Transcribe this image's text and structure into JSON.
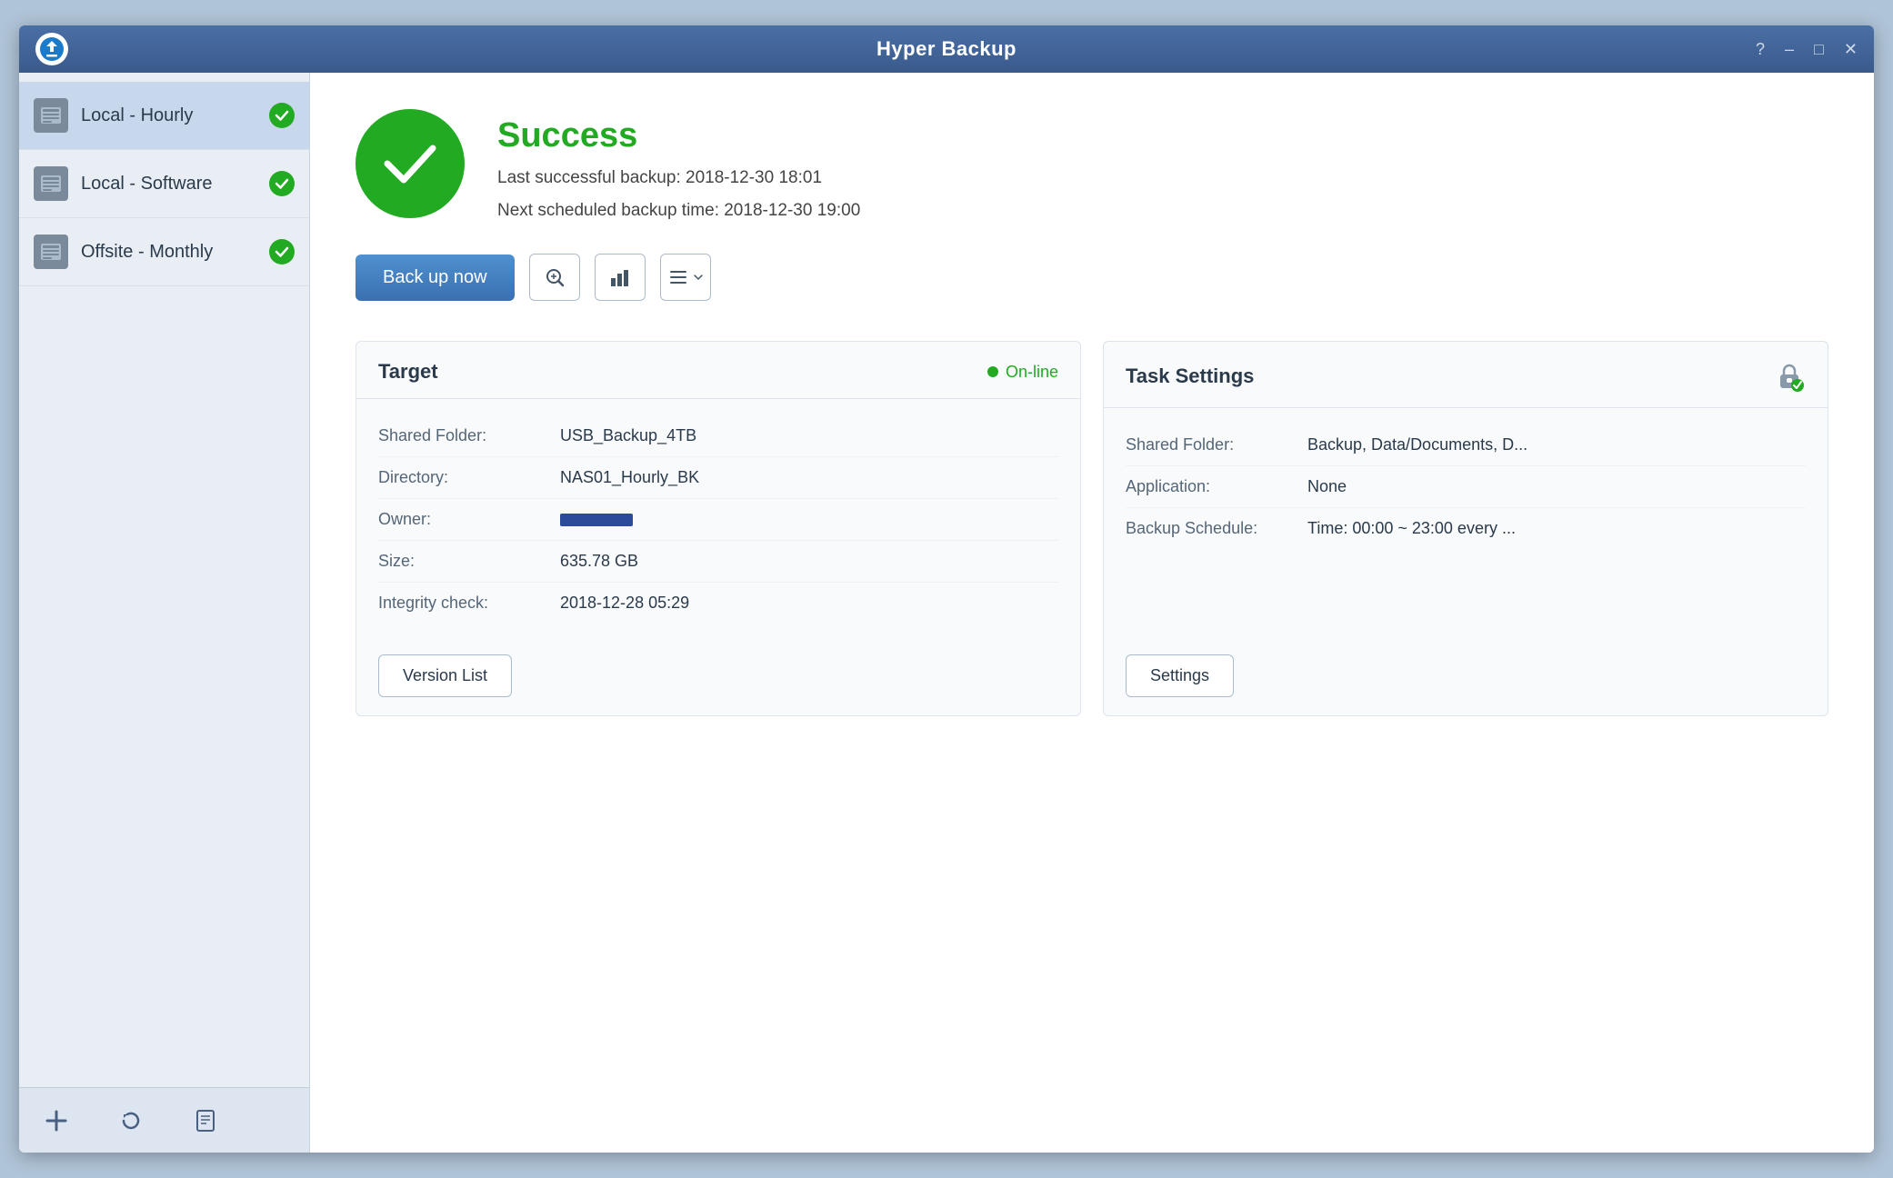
{
  "app": {
    "title": "Hyper Backup"
  },
  "titlebar": {
    "help_label": "?",
    "minimize_label": "–",
    "maximize_label": "□",
    "close_label": "✕"
  },
  "sidebar": {
    "items": [
      {
        "id": "local-hourly",
        "label": "Local - Hourly",
        "status": "success",
        "active": true
      },
      {
        "id": "local-software",
        "label": "Local - Software",
        "status": "success",
        "active": false
      },
      {
        "id": "offsite-monthly",
        "label": "Offsite - Monthly",
        "status": "success",
        "active": false
      }
    ],
    "footer_buttons": [
      {
        "id": "add",
        "icon": "+"
      },
      {
        "id": "restore",
        "icon": "↺"
      },
      {
        "id": "log",
        "icon": "📄"
      }
    ]
  },
  "main": {
    "status": {
      "title": "Success",
      "last_backup": "Last successful backup: 2018-12-30 18:01",
      "next_backup": "Next scheduled backup time: 2018-12-30 19:00"
    },
    "actions": {
      "back_up_now": "Back up now",
      "search_tooltip": "Browse backup versions",
      "chart_tooltip": "Backup statistics",
      "menu_tooltip": "More options"
    },
    "target_panel": {
      "title": "Target",
      "online_status": "On-line",
      "fields": [
        {
          "label": "Shared Folder:",
          "value": "USB_Backup_4TB"
        },
        {
          "label": "Directory:",
          "value": "NAS01_Hourly_BK"
        },
        {
          "label": "Owner:",
          "value": "bar"
        },
        {
          "label": "Size:",
          "value": "635.78 GB"
        },
        {
          "label": "Integrity check:",
          "value": "2018-12-28 05:29"
        }
      ],
      "version_list_btn": "Version List"
    },
    "task_panel": {
      "title": "Task Settings",
      "fields": [
        {
          "label": "Shared Folder:",
          "value": "Backup, Data/Documents, D..."
        },
        {
          "label": "Application:",
          "value": "None"
        },
        {
          "label": "Backup Schedule:",
          "value": "Time: 00:00 ~ 23:00 every ..."
        }
      ],
      "settings_btn": "Settings"
    }
  }
}
